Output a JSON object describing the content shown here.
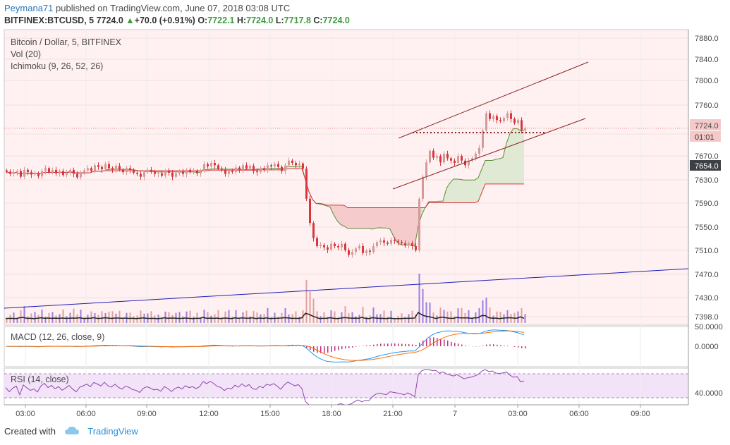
{
  "header": {
    "author": "Peymana71",
    "published": " published on TradingView.com, June 07, 2018 03:08 UTC",
    "symbol": "BITFINEX:BTCUSD, 5",
    "last": "7724.0",
    "change_arrow": "▲",
    "change": "+70.0 (+0.91%)",
    "o_label": "O:",
    "o_value": "7722.1",
    "h_label": "H:",
    "h_value": "7724.0",
    "l_label": "L:",
    "l_value": "7717.8",
    "c_label": "C:",
    "c_value": "7724.0"
  },
  "legend": {
    "title": "Bitcoin / Dollar, 5, BITFINEX",
    "vol": "Vol (20)",
    "ichimoku": "Ichimoku (9, 26, 52, 26)"
  },
  "macd": {
    "title": "MACD (12, 26, close, 9)",
    "ticks": [
      "50.0000",
      "0.0000"
    ]
  },
  "rsi": {
    "title": "RSI (14, close)",
    "ticks": [
      "40.0000"
    ]
  },
  "price_axis": {
    "ticks": [
      "7880.0",
      "7840.0",
      "7800.0",
      "7760.0",
      "7724.0",
      "7670.0",
      "7654.0",
      "7630.0",
      "7590.0",
      "7550.0",
      "7510.0",
      "7470.0",
      "7430.0",
      "7398.0"
    ],
    "last_price": "7724.0",
    "countdown": "01:01",
    "marked_price": "7654.0"
  },
  "time_axis": [
    "03:00",
    "06:00",
    "09:00",
    "12:00",
    "15:00",
    "18:00",
    "21:00",
    "7",
    "03:00",
    "06:00",
    "09:00"
  ],
  "footer": {
    "created": "Created with",
    "brand": "TradingView"
  },
  "colors": {
    "up": "#d49a9a",
    "down": "#d9363e",
    "cloud_up": "#f5c6c6",
    "cloud_down": "#dde8cf",
    "channel": "#8b2323",
    "trendline": "#1c1cb8",
    "macd": "#2196f3",
    "signal": "#ff6d00",
    "rsi": "#8e44ad",
    "rsi_band": "#f0e0f7",
    "bg": "#fff1f1"
  },
  "chart_data": {
    "type": "candlestick",
    "series_note": "BTCUSD 5-minute candles",
    "ylim": [
      7390,
      7895
    ],
    "candles_close": [
      7649,
      7645,
      7648,
      7650,
      7640,
      7652,
      7648,
      7644,
      7646,
      7641,
      7650,
      7655,
      7648,
      7652,
      7646,
      7650,
      7643,
      7647,
      7652,
      7645,
      7639,
      7648,
      7651,
      7655,
      7650,
      7660,
      7657,
      7653,
      7662,
      7655,
      7652,
      7659,
      7652,
      7648,
      7655,
      7652,
      7647,
      7645,
      7640,
      7648,
      7652,
      7649,
      7645,
      7646,
      7642,
      7651,
      7647,
      7640,
      7646,
      7649,
      7645,
      7652,
      7648,
      7650,
      7646,
      7650,
      7662,
      7658,
      7664,
      7660,
      7654,
      7652,
      7645,
      7650,
      7648,
      7656,
      7652,
      7660,
      7654,
      7659,
      7650,
      7648,
      7655,
      7652,
      7660,
      7658,
      7662,
      7657,
      7650,
      7660,
      7668,
      7664,
      7660,
      7663,
      7654,
      7602,
      7560,
      7534,
      7520,
      7522,
      7518,
      7514,
      7524,
      7520,
      7518,
      7524,
      7513,
      7505,
      7510,
      7516,
      7520,
      7508,
      7512,
      7510,
      7520,
      7527,
      7530,
      7526,
      7524,
      7531,
      7529,
      7527,
      7525,
      7521,
      7525,
      7520,
      7513,
      7602,
      7640,
      7665,
      7685,
      7673,
      7676,
      7665,
      7680,
      7672,
      7668,
      7664,
      7676,
      7668,
      7660,
      7668,
      7672,
      7680,
      7690,
      7720,
      7750,
      7740,
      7745,
      7738,
      7736,
      7742,
      7750,
      7740,
      7733,
      7738,
      7720,
      7724
    ]
  }
}
